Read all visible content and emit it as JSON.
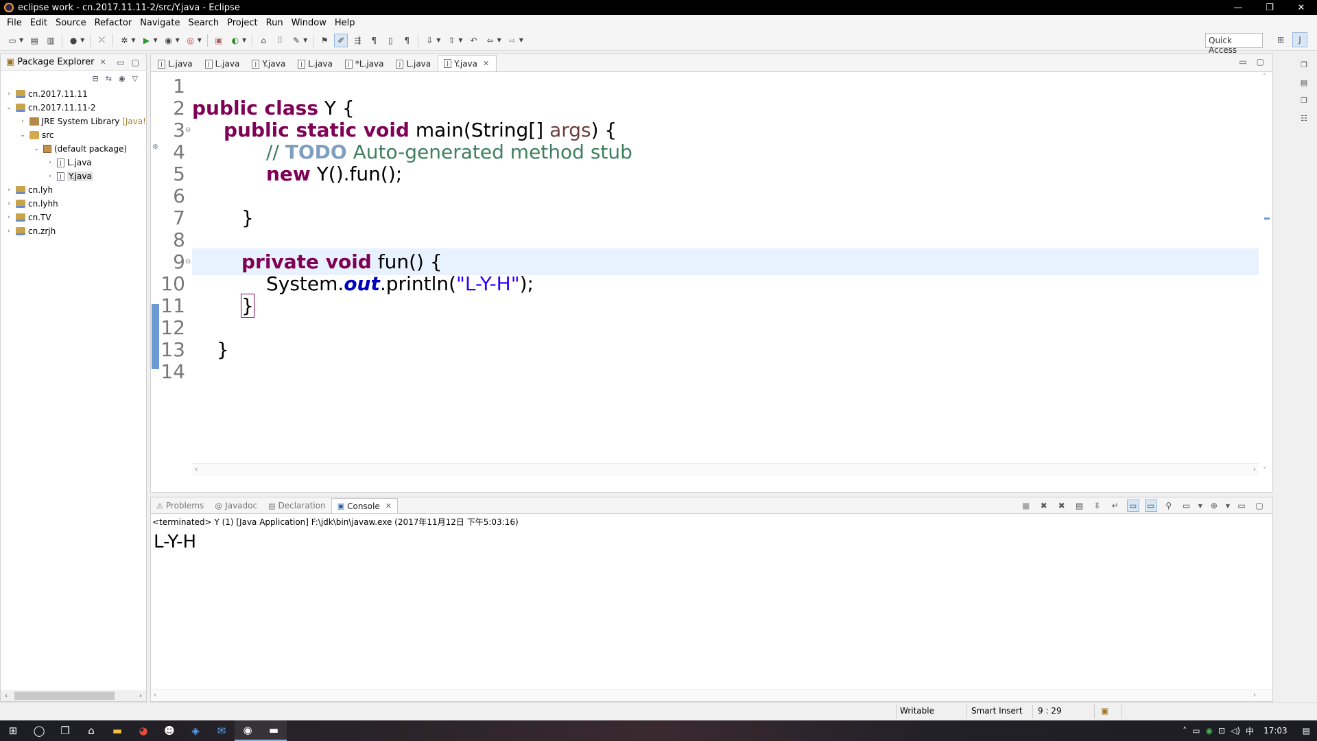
{
  "window": {
    "title": "eclipse work - cn.2017.11.11-2/src/Y.java - Eclipse",
    "controls": [
      "—",
      "❐",
      "✕"
    ]
  },
  "menu": [
    "File",
    "Edit",
    "Source",
    "Refactor",
    "Navigate",
    "Search",
    "Project",
    "Run",
    "Window",
    "Help"
  ],
  "toolbar": {
    "quick_access": "Quick Access"
  },
  "package_explorer": {
    "title": "Package Explorer",
    "tree": [
      {
        "label": "cn.2017.11.11",
        "expanded": false,
        "icon": "project-icon"
      },
      {
        "label": "cn.2017.11.11-2",
        "expanded": true,
        "icon": "project-icon"
      },
      {
        "label": "JRE System Library",
        "extra": "[Java!",
        "icon": "library-icon"
      },
      {
        "label": "src",
        "icon": "source-folder-icon"
      },
      {
        "label": "(default package)",
        "icon": "package-icon"
      },
      {
        "label": "L.java",
        "icon": "java-file-icon"
      },
      {
        "label": "Y.java",
        "icon": "java-file-icon",
        "selected": true
      },
      {
        "label": "cn.lyh",
        "icon": "project-icon"
      },
      {
        "label": "cn.lyhh",
        "icon": "project-icon"
      },
      {
        "label": "cn.TV",
        "icon": "project-icon"
      },
      {
        "label": "cn.zrjh",
        "icon": "project-icon"
      }
    ]
  },
  "editor": {
    "tabs": [
      {
        "label": "L.java",
        "active": false
      },
      {
        "label": "L.java",
        "active": false
      },
      {
        "label": "Y.java",
        "active": false
      },
      {
        "label": "L.java",
        "active": false
      },
      {
        "label": "*L.java",
        "active": false
      },
      {
        "label": "L.java",
        "active": false
      },
      {
        "label": "Y.java",
        "active": true
      }
    ],
    "line_numbers": [
      "1",
      "2",
      "3",
      "4",
      "5",
      "6",
      "7",
      "8",
      "9",
      "10",
      "11",
      "12",
      "13",
      "14"
    ],
    "code": {
      "l2_kw": "public class",
      "l2_rest": " Y {",
      "l3_kw": "public static void",
      "l3_a": " main(String[] ",
      "l3_arg": "args",
      "l3_b": ") {",
      "l4_c1": "// ",
      "l4_todo": "TODO",
      "l4_c2": " Auto-generated method stub",
      "l5_kw": "new",
      "l5_rest": " Y().fun();",
      "l7": "}",
      "l9_kw": "private void",
      "l9_rest": " fun() {",
      "l10_a": "System.",
      "l10_fld": "out",
      "l10_b": ".println(",
      "l10_str": "\"L-Y-H\"",
      "l10_c": ");",
      "l11": "}",
      "l13": "}"
    },
    "current_line": 9
  },
  "console": {
    "tabs": [
      {
        "label": "Problems",
        "active": false,
        "icon": "problems-icon"
      },
      {
        "label": "Javadoc",
        "active": false,
        "icon": "javadoc-icon"
      },
      {
        "label": "Declaration",
        "active": false,
        "icon": "declaration-icon"
      },
      {
        "label": "Console",
        "active": true,
        "icon": "console-icon"
      }
    ],
    "terminated": "<terminated> Y (1) [Java Application] F:\\jdk\\bin\\javaw.exe (2017年11月12日 下午5:03:16)",
    "output": "L-Y-H"
  },
  "status": {
    "writable": "Writable",
    "insert_mode": "Smart Insert",
    "position": "9 : 29"
  },
  "taskbar": {
    "clock": "17:03",
    "ime": "中"
  }
}
